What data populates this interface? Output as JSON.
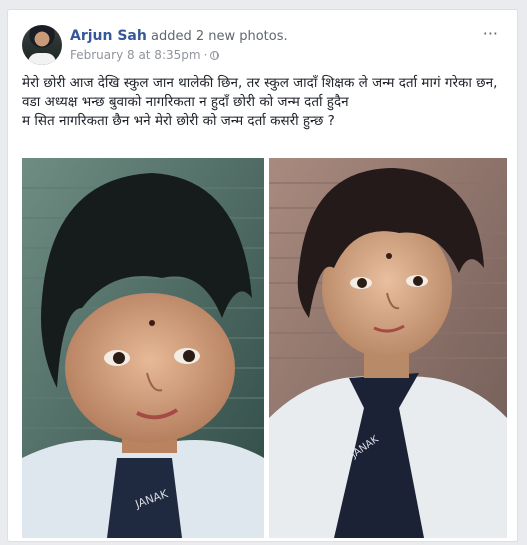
{
  "post": {
    "author": "Arjun Sah",
    "action": "added 2 new photos.",
    "timestamp": "February 8 at 8:35pm",
    "separator": "·",
    "privacy_icon": "globe-icon",
    "more_icon": "···",
    "text": [
      "मेरो छोरी आज देखि स्कुल जान थालेकी छिन, तर स्कुल जादाँ शिक्षक ले जन्म दर्ता मागं गरेका छन,",
      "वडा अध्यक्ष भन्छ बुवाको नागरिकता न हुदाँ छोरी को जन्म दर्ता हुदैन",
      "म सित नागरिकता छैन भने मेरो छोरी को जन्म दर्ता कसरी हुन्छ ?"
    ],
    "photos": [
      {
        "alt_icon": "child-portrait-photo",
        "tie_text": "JANAK"
      },
      {
        "alt_icon": "child-portrait-photo",
        "tie_text": "JANAK"
      }
    ]
  },
  "colors": {
    "link": "#365899",
    "meta": "#90949c",
    "text": "#1d2129",
    "background": "#e9ebee"
  }
}
